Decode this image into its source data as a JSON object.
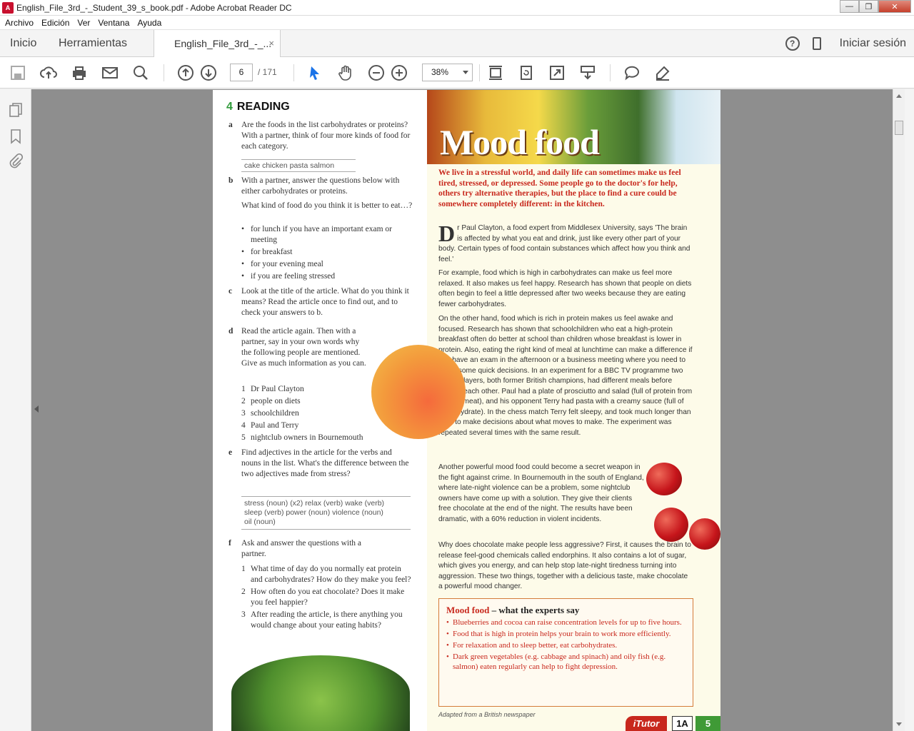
{
  "window": {
    "title": "English_File_3rd_-_Student_39_s_book.pdf - Adobe Acrobat Reader DC",
    "minimize": "—",
    "maximize": "❐",
    "close": "✕"
  },
  "menu": [
    "Archivo",
    "Edición",
    "Ver",
    "Ventana",
    "Ayuda"
  ],
  "tabs": {
    "home": "Inicio",
    "tools": "Herramientas",
    "doc": "English_File_3rd_-_...",
    "doc_close": "×",
    "help": "?",
    "signin": "Iniciar sesión"
  },
  "toolbar": {
    "page_current": "6",
    "page_total": "/ 171",
    "zoom": "38%",
    "icons": [
      "save-icon",
      "upload-icon",
      "print-icon",
      "email-icon",
      "search-icon",
      "prev-page-icon",
      "next-page-icon",
      "select-cursor-icon",
      "hand-icon",
      "zoom-out-icon",
      "zoom-in-icon",
      "fit-page-icon",
      "rotate-icon",
      "fullscreen-icon",
      "scroll-mode-icon",
      "comment-icon",
      "highlight-icon"
    ]
  },
  "leftpanel": {
    "icons": [
      "pages-icon",
      "bookmark-icon",
      "attachment-icon"
    ]
  },
  "doc": {
    "section_num": "4",
    "section_title": "READING",
    "qa": {
      "label": "a",
      "text": "Are the foods in the list carbohydrates or proteins? With a partner, think of four more kinds of food for each category."
    },
    "foods": "cake   chicken   pasta   salmon",
    "qb": {
      "label": "b",
      "text": "With a partner, answer the questions below with either carbohydrates or proteins."
    },
    "qb_sub": "What kind of food do you think it is better to eat…?",
    "qb_bullets": [
      "for lunch if you have an important exam or meeting",
      "for breakfast",
      "for your evening meal",
      "if you are feeling stressed"
    ],
    "qc": {
      "label": "c",
      "text": "Look at the title of the article. What do you think it means? Read the article once to find out, and to check your answers to b."
    },
    "qd": {
      "label": "d",
      "text": "Read the article again. Then with a partner, say in your own words why the following people are mentioned. Give as much information as you can."
    },
    "qd_list": [
      {
        "n": "1",
        "t": "Dr Paul Clayton"
      },
      {
        "n": "2",
        "t": "people on diets"
      },
      {
        "n": "3",
        "t": "schoolchildren"
      },
      {
        "n": "4",
        "t": "Paul and Terry"
      },
      {
        "n": "5",
        "t": "nightclub owners in Bournemouth"
      }
    ],
    "qe": {
      "label": "e",
      "text": "Find adjectives in the article for the verbs and nouns in the list. What's the difference between the two adjectives made from stress?"
    },
    "qe_words_1": "stress (noun) (x2)   relax (verb)   wake (verb)",
    "qe_words_2": "sleep (verb)   power (noun)   violence (noun)",
    "qe_words_3": "oil (noun)",
    "qf": {
      "label": "f",
      "text": "Ask and answer the questions with a partner."
    },
    "qf_list": [
      {
        "n": "1",
        "t": "What time of day do you normally eat protein and carbohydrates? How do they make you feel?"
      },
      {
        "n": "2",
        "t": "How often do you eat chocolate? Does it make you feel happier?"
      },
      {
        "n": "3",
        "t": "After reading the article, is there anything you would change about your eating habits?"
      }
    ],
    "article_title": "Mood food",
    "intro": "We live in a stressful world, and daily life can sometimes make us feel tired, stressed, or depressed. Some people go to the doctor's for help, others try alternative therapies, but the place to find a cure could be somewhere completely different: in the kitchen.",
    "dropcap": "D",
    "p1": "r Paul Clayton, a food expert from Middlesex University, says 'The brain is affected by what you eat and drink, just like every other part of your body. Certain types of food contain substances which affect how you think and feel.'",
    "p2": "For example, food which is high in carbohydrates can make us feel more relaxed. It also makes us feel happy. Research has shown that people on diets often begin to feel a little depressed after two weeks because they are eating fewer carbohydrates.",
    "p3": "On the other hand, food which is rich in protein makes us feel awake and focused. Research has shown that schoolchildren who eat a high-protein breakfast often do better at school than children whose breakfast is lower in protein. Also, eating the right kind of meal at lunchtime can make a difference if you have an exam in the afternoon or a business meeting where you need to make some quick decisions. In an experiment for a BBC TV programme two chess players, both former British champions, had different meals before playing each other. Paul had a plate of prosciutto and salad (full of protein from the red meat), and his opponent Terry had pasta with a creamy sauce (full of carbohydrate). In the chess match Terry felt sleepy, and took much longer than Paul to make decisions about what moves to make. The experiment was repeated several times with the same result.",
    "p4": "Another powerful mood food could become a secret weapon in the fight against crime. In Bournemouth in the south of England, where late-night violence can be a problem, some nightclub owners have come up with a solution. They give their clients free chocolate at the end of the night. The results have been dramatic, with a 60% reduction in violent incidents.",
    "p5": "Why does chocolate make people less aggressive? First, it causes the brain to release feel-good chemicals called endorphins. It also contains a lot of sugar, which gives you energy, and can help stop late-night tiredness turning into aggression. These two things, together with a delicious taste, make chocolate a powerful mood changer.",
    "box_title_red": "Mood food",
    "box_title_rest": " – what the experts say",
    "box_items": [
      "Blueberries and cocoa can raise concentration levels for up to five hours.",
      "Food that is high in protein helps your brain to work more efficiently.",
      "For relaxation and to sleep better, eat carbohydrates.",
      "Dark green vegetables (e.g. cabbage and spinach) and oily fish (e.g. salmon) eaten regularly can help to fight depression."
    ],
    "adapted": "Adapted from a British newspaper",
    "itutor": "iTutor",
    "unit": "1A",
    "page_num": "5"
  }
}
